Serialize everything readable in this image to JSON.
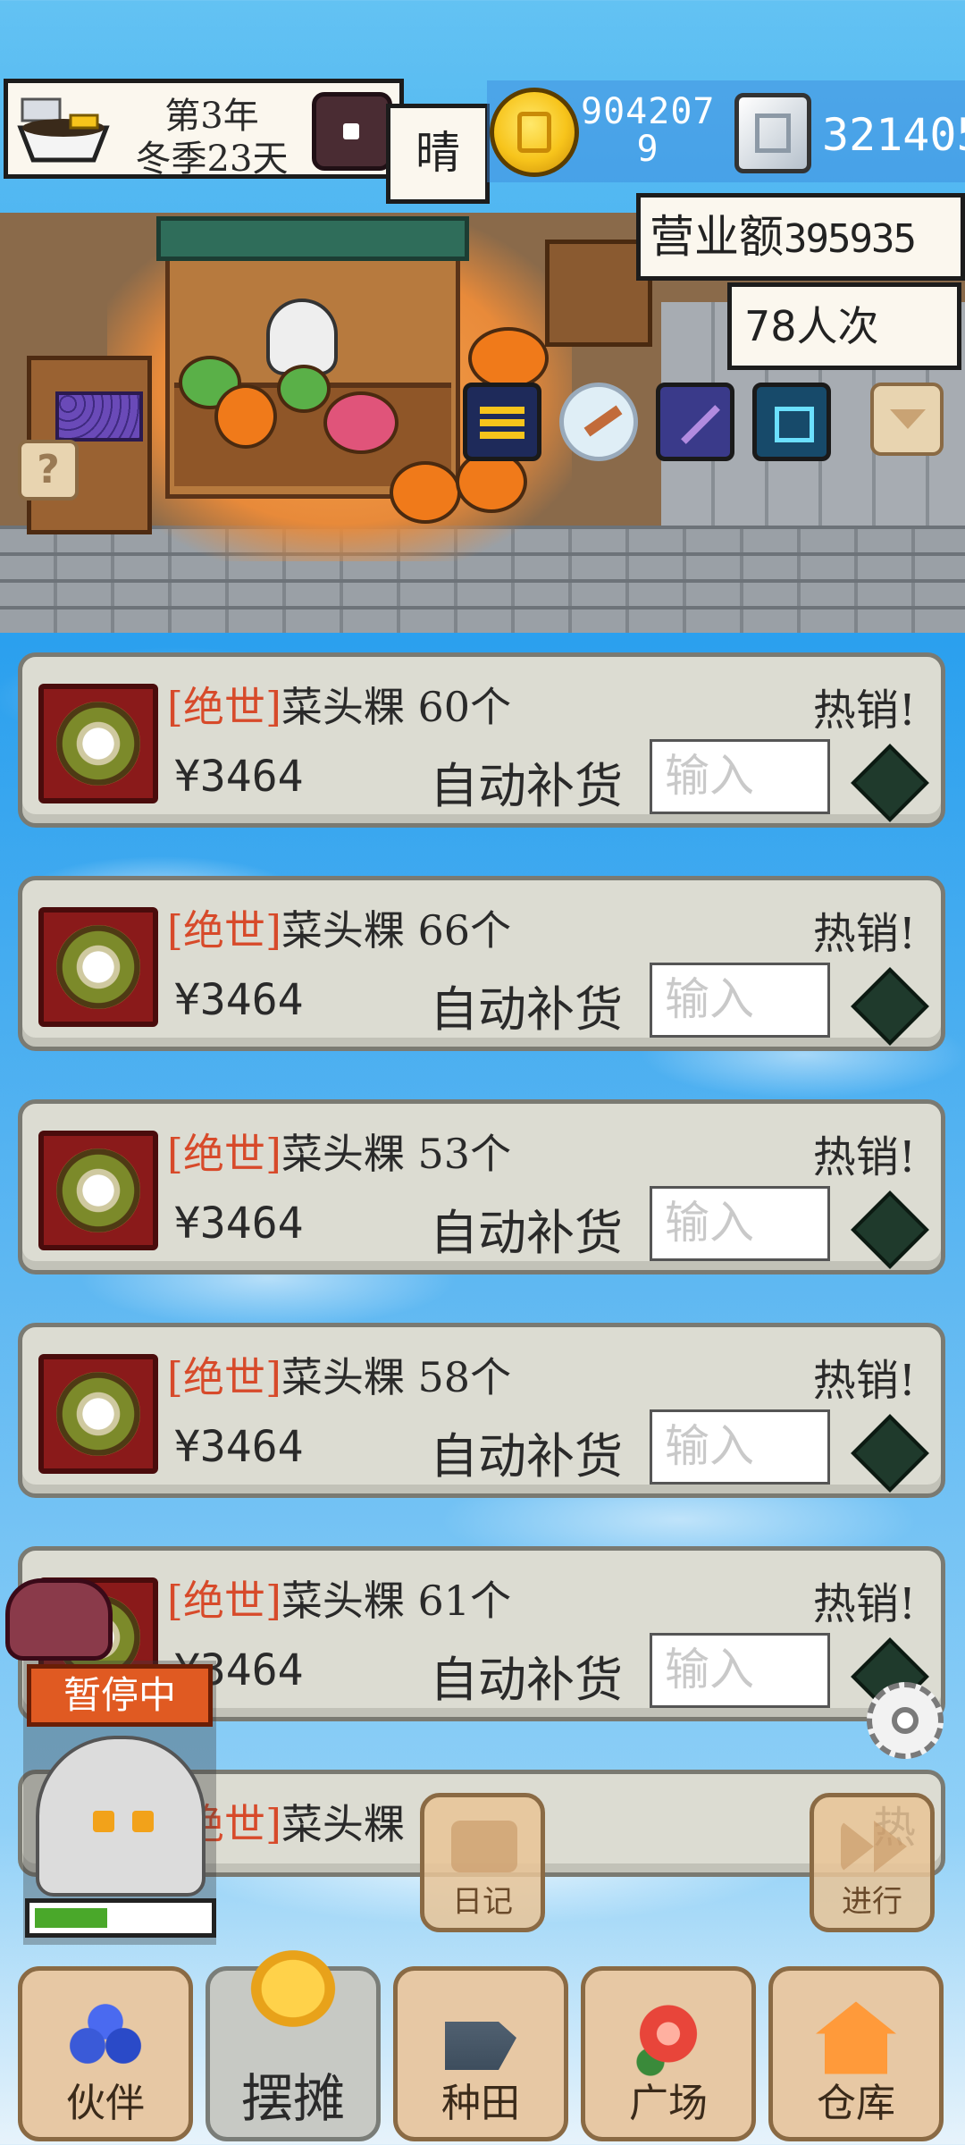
{
  "hud": {
    "year_label": "第3年",
    "season_label": "冬季23天",
    "weather": "晴",
    "gold_line1": "904207",
    "gold_line2": "9",
    "silver": "321405"
  },
  "shop": {
    "revenue_label": "营业额",
    "revenue_value": "395935",
    "visitors": "78人次",
    "help_label": "?"
  },
  "items": [
    {
      "grade": "[绝世]",
      "name": "菜头粿",
      "count": "60个",
      "hot": "热销!",
      "price": "¥3464",
      "auto_restock": "自动补货",
      "input_placeholder": "输入"
    },
    {
      "grade": "[绝世]",
      "name": "菜头粿",
      "count": "66个",
      "hot": "热销!",
      "price": "¥3464",
      "auto_restock": "自动补货",
      "input_placeholder": "输入"
    },
    {
      "grade": "[绝世]",
      "name": "菜头粿",
      "count": "53个",
      "hot": "热销!",
      "price": "¥3464",
      "auto_restock": "自动补货",
      "input_placeholder": "输入"
    },
    {
      "grade": "[绝世]",
      "name": "菜头粿",
      "count": "58个",
      "hot": "热销!",
      "price": "¥3464",
      "auto_restock": "自动补货",
      "input_placeholder": "输入"
    },
    {
      "grade": "[绝世]",
      "name": "菜头粿",
      "count": "61个",
      "hot": "热销!",
      "price": "¥3464",
      "auto_restock": "自动补货",
      "input_placeholder": "输入"
    },
    {
      "grade": "[绝世]",
      "name": "菜头粿",
      "count": "",
      "hot": "热",
      "price": "",
      "auto_restock": "",
      "input_placeholder": ""
    }
  ],
  "status": {
    "paused_label": "暂停中",
    "progress": 0.42
  },
  "actions": {
    "diary_label": "日记",
    "proceed_label": "进行"
  },
  "nav": {
    "tabs": [
      {
        "label": "伙伴",
        "icon": "partners-icon"
      },
      {
        "label": "摆摊",
        "icon": "stall-coins-icon",
        "active": true
      },
      {
        "label": "种田",
        "icon": "watering-can-icon"
      },
      {
        "label": "广场",
        "icon": "flower-icon"
      },
      {
        "label": "仓库",
        "icon": "house-icon"
      }
    ]
  },
  "colors": {
    "grade_text": "#d74a2a",
    "paused_badge": "#e05a22",
    "progress_fill": "#4aa82a"
  }
}
